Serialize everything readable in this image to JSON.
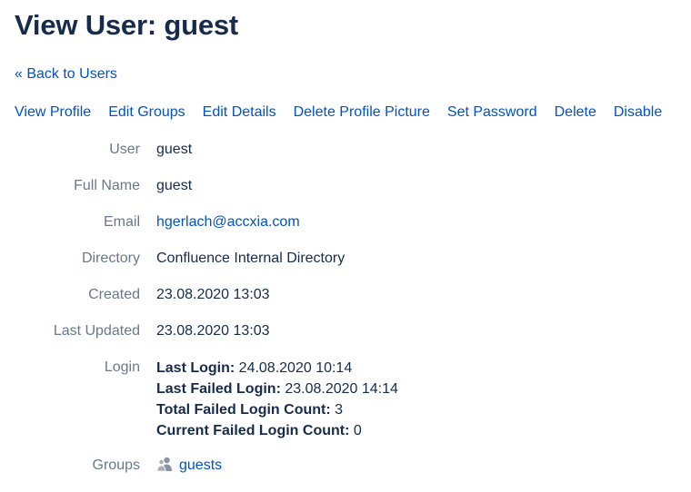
{
  "page": {
    "title": "View User: guest",
    "back_link": "« Back to Users"
  },
  "actions": [
    "View Profile",
    "Edit Groups",
    "Edit Details",
    "Delete Profile Picture",
    "Set Password",
    "Delete",
    "Disable"
  ],
  "details": {
    "user_label": "User",
    "user_value": "guest",
    "fullname_label": "Full Name",
    "fullname_value": "guest",
    "email_label": "Email",
    "email_value": "hgerlach@accxia.com",
    "directory_label": "Directory",
    "directory_value": "Confluence Internal Directory",
    "created_label": "Created",
    "created_value": "23.08.2020 13:03",
    "updated_label": "Last Updated",
    "updated_value": "23.08.2020 13:03",
    "login_label": "Login",
    "login": {
      "last_login_label": "Last Login:",
      "last_login_value": " 24.08.2020 10:14",
      "last_failed_label": "Last Failed Login:",
      "last_failed_value": " 23.08.2020 14:14",
      "total_failed_label": "Total Failed Login Count:",
      "total_failed_value": " 3",
      "current_failed_label": "Current Failed Login Count:",
      "current_failed_value": " 0"
    },
    "groups_label": "Groups",
    "groups": [
      {
        "name": "guests",
        "icon": "group-icon"
      }
    ]
  },
  "colors": {
    "link": "#0052cc",
    "label": "#6b778c",
    "text": "#172b4d"
  }
}
